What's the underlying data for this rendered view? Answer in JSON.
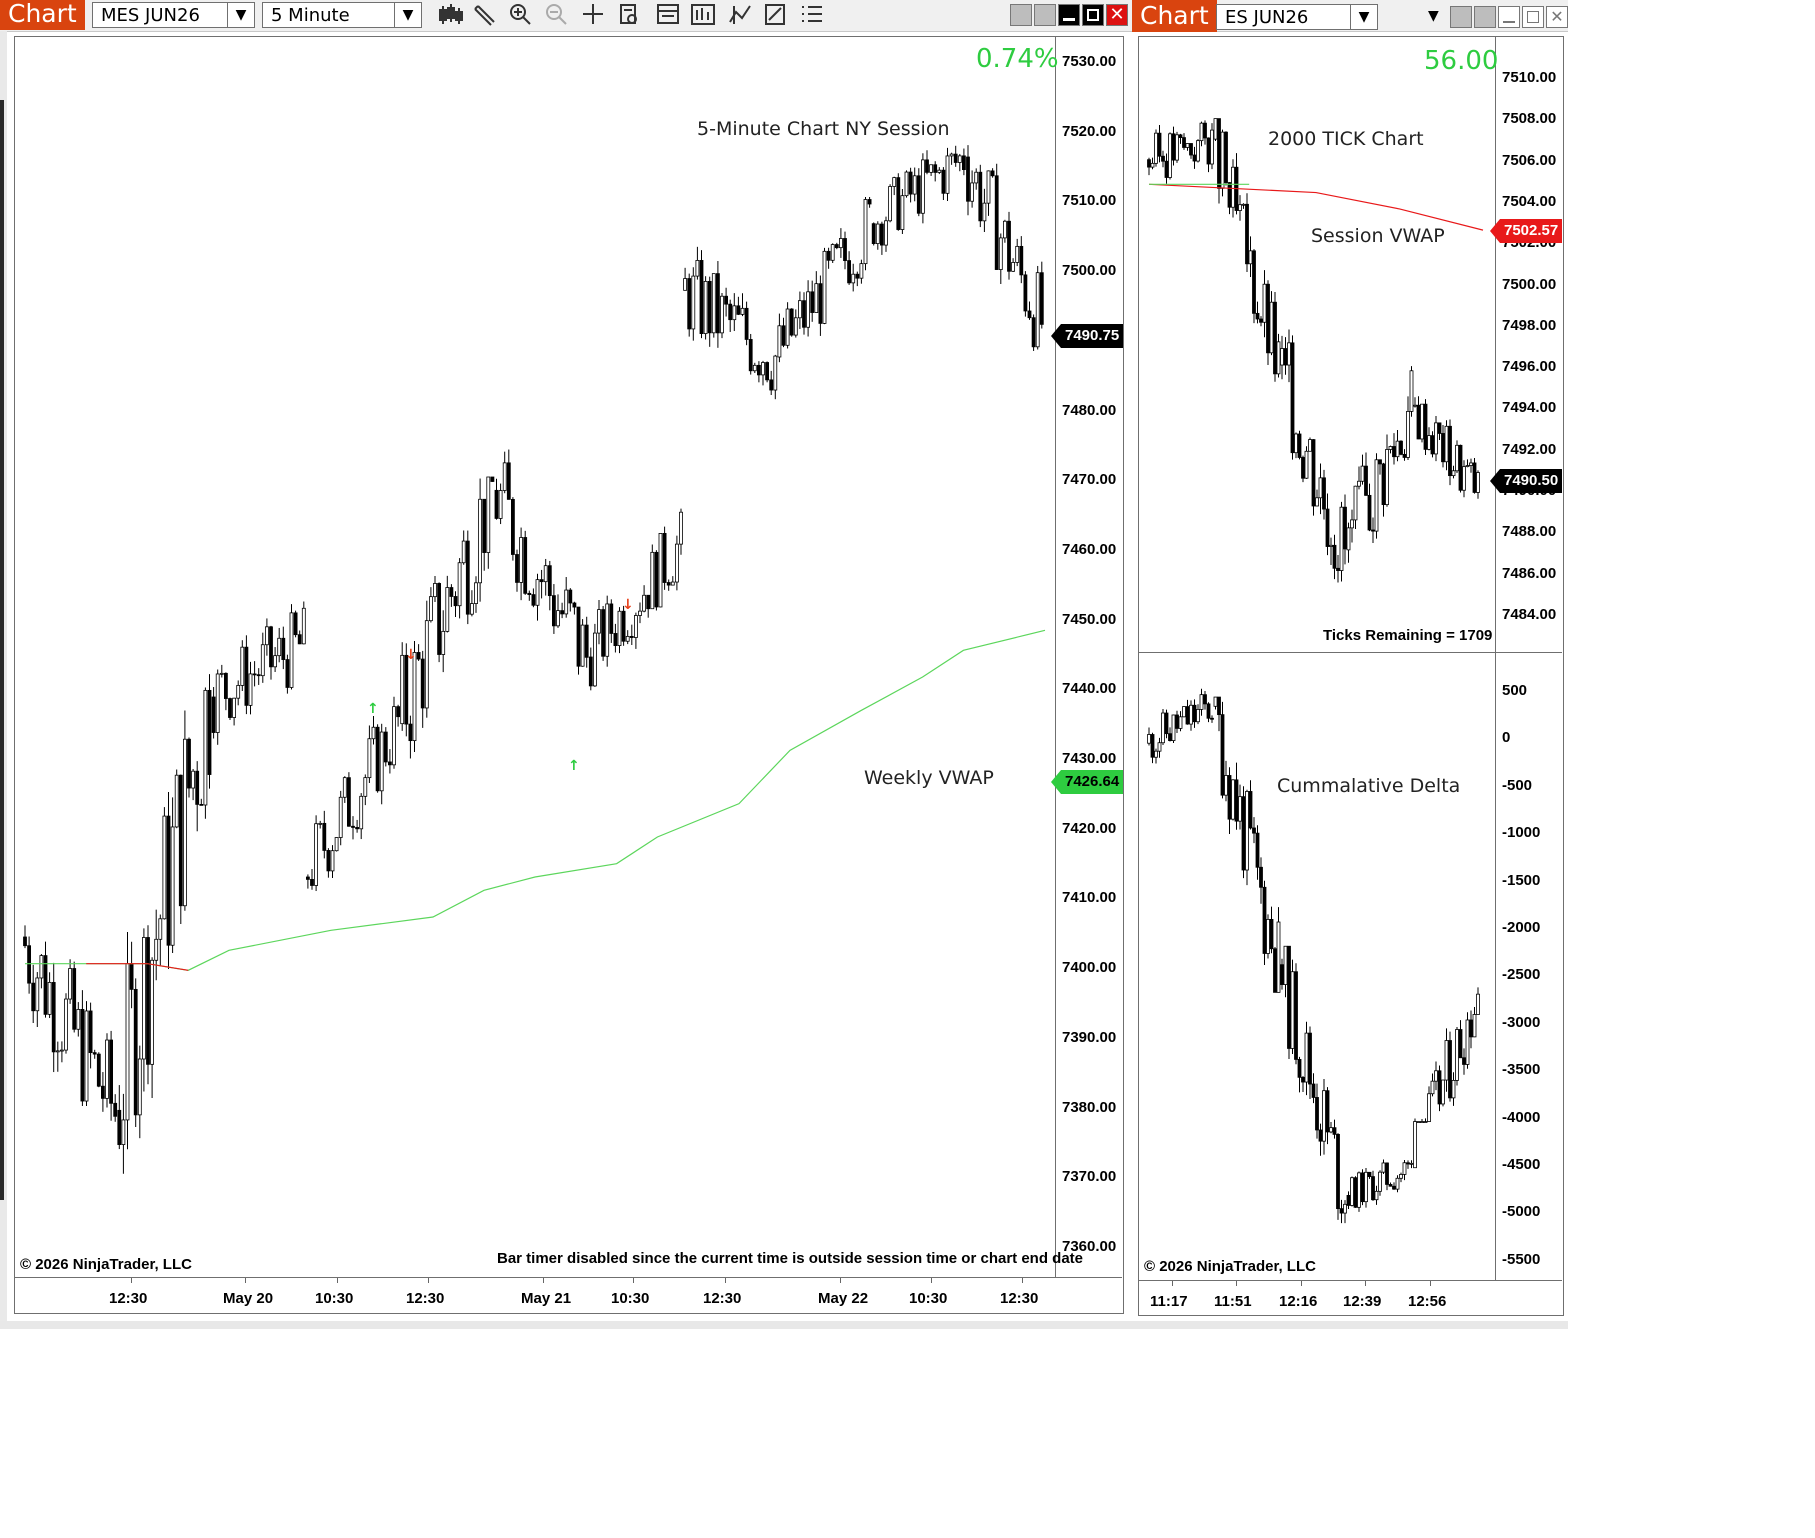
{
  "left_window": {
    "tab_label": "Chart",
    "instrument": "MES JUN26",
    "timeframe": "5 Minute",
    "pct_change": "0.74%",
    "title_label": "5-Minute Chart NY Session",
    "vwap_label": "Weekly VWAP",
    "last_price": "7490.75",
    "vwap_price": "7426.64",
    "copyright": "© 2026 NinjaTrader, LLC",
    "bar_timer_msg": "Bar timer disabled since the current time is outside session time or chart end date",
    "y_ticks": [
      "7530.00",
      "7520.00",
      "7510.00",
      "7500.00",
      "7490.00",
      "7480.00",
      "7470.00",
      "7460.00",
      "7450.00",
      "7440.00",
      "7430.00",
      "7420.00",
      "7410.00",
      "7400.00",
      "7390.00",
      "7380.00",
      "7370.00",
      "7360.00"
    ],
    "x_ticks": [
      "12:30",
      "May 20",
      "10:30",
      "12:30",
      "May 21",
      "10:30",
      "12:30",
      "May 22",
      "10:30",
      "12:30"
    ]
  },
  "right_window": {
    "tab_label": "Chart",
    "instrument": "ES JUN26",
    "net_change": "56.00",
    "title_label": "2000 TICK Chart",
    "vwap_label": "Session VWAP",
    "ticks_remaining": "Ticks Remaining = 1709",
    "last_price": "7490.50",
    "vwap_price": "7502.57",
    "delta_label": "Cummalative Delta",
    "copyright": "© 2026 NinjaTrader, LLC",
    "y_ticks": [
      "7510.00",
      "7508.00",
      "7506.00",
      "7504.00",
      "7502.00",
      "7500.00",
      "7498.00",
      "7496.00",
      "7494.00",
      "7492.00",
      "7490.00",
      "7488.00",
      "7486.00",
      "7484.00"
    ],
    "delta_ticks": [
      "500",
      "0",
      "-500",
      "-1000",
      "-1500",
      "-2000",
      "-2500",
      "-3000",
      "-3500",
      "-4000",
      "-4500",
      "-5000",
      "-5500"
    ],
    "x_ticks": [
      "11:17",
      "11:51",
      "12:16",
      "12:39",
      "12:56"
    ]
  },
  "colors": {
    "accent": "#d9440f",
    "up_green": "#2ecc40",
    "vwap_red": "#e8191a",
    "vwap_green": "#5cd65c",
    "candle": "#000000"
  },
  "icons": [
    "candlestick-icon",
    "draw-pencil-icon",
    "zoom-in-icon",
    "zoom-out-icon",
    "crosshair-icon",
    "data-box-icon",
    "properties-icon",
    "bar-chart-icon",
    "indicators-icon",
    "strategies-icon",
    "list-icon"
  ],
  "chart_data": [
    {
      "type": "candlestick",
      "title": "5-Minute Chart NY Session",
      "instrument": "MES JUN26",
      "ylim": [
        7355,
        7535
      ],
      "series": [
        {
          "name": "Weekly VWAP",
          "points": [
            [
              0,
              7399
            ],
            [
              0.12,
              7399
            ],
            [
              0.16,
              7398
            ],
            [
              0.2,
              7401
            ],
            [
              0.3,
              7404
            ],
            [
              0.4,
              7406
            ],
            [
              0.45,
              7410
            ],
            [
              0.5,
              7412
            ],
            [
              0.58,
              7414
            ],
            [
              0.62,
              7418
            ],
            [
              0.7,
              7423
            ],
            [
              0.75,
              7431
            ],
            [
              0.82,
              7437
            ],
            [
              0.88,
              7442
            ],
            [
              0.92,
              7446
            ],
            [
              1,
              7449
            ]
          ]
        }
      ],
      "segments": [
        {
          "start": 7403,
          "end": 7377,
          "min": 7364,
          "max": 7416
        },
        {
          "start": 7377,
          "end": 7439,
          "min": 7367,
          "max": 7452
        },
        {
          "start": 7439,
          "end": 7447,
          "min": 7422,
          "max": 7455
        },
        {
          "start": 7412,
          "end": 7435,
          "min": 7408,
          "max": 7443
        },
        {
          "start": 7435,
          "end": 7470,
          "min": 7418,
          "max": 7472
        },
        {
          "start": 7470,
          "end": 7445,
          "min": 7440,
          "max": 7487
        },
        {
          "start": 7445,
          "end": 7462,
          "min": 7440,
          "max": 7470
        },
        {
          "start": 7500,
          "end": 7490,
          "min": 7478,
          "max": 7516
        },
        {
          "start": 7490,
          "end": 7510,
          "min": 7482,
          "max": 7514
        },
        {
          "start": 7510,
          "end": 7520,
          "min": 7498,
          "max": 7524
        },
        {
          "start": 7520,
          "end": 7490,
          "min": 7484,
          "max": 7522
        }
      ]
    },
    {
      "type": "candlestick",
      "title": "2000 TICK Chart",
      "instrument": "ES JUN26",
      "ylim": [
        7483,
        7511
      ],
      "series": [
        {
          "name": "Session VWAP",
          "points": [
            [
              0,
              7504.8
            ],
            [
              0.5,
              7504.4
            ],
            [
              0.75,
              7503.6
            ],
            [
              1,
              7502.57
            ]
          ]
        }
      ],
      "segments": [
        {
          "start": 7506,
          "end": 7507,
          "min": 7503,
          "max": 7510
        },
        {
          "start": 7507,
          "end": 7496,
          "min": 7495,
          "max": 7508
        },
        {
          "start": 7496,
          "end": 7487,
          "min": 7484,
          "max": 7499
        },
        {
          "start": 7487,
          "end": 7494,
          "min": 7484,
          "max": 7497
        },
        {
          "start": 7494,
          "end": 7490,
          "min": 7488,
          "max": 7496
        }
      ]
    },
    {
      "type": "candlestick",
      "title": "Cummalative Delta",
      "ylim": [
        -5700,
        650
      ],
      "segments": [
        {
          "start": -100,
          "end": 300,
          "min": -850,
          "max": 550
        },
        {
          "start": 300,
          "end": -2500,
          "min": -2800,
          "max": 400
        },
        {
          "start": -2500,
          "end": -5000,
          "min": -5300,
          "max": -2300
        },
        {
          "start": -5000,
          "end": -4700,
          "min": -5600,
          "max": -4500
        },
        {
          "start": -4700,
          "end": -2800,
          "min": -4200,
          "max": -2000
        }
      ]
    }
  ]
}
